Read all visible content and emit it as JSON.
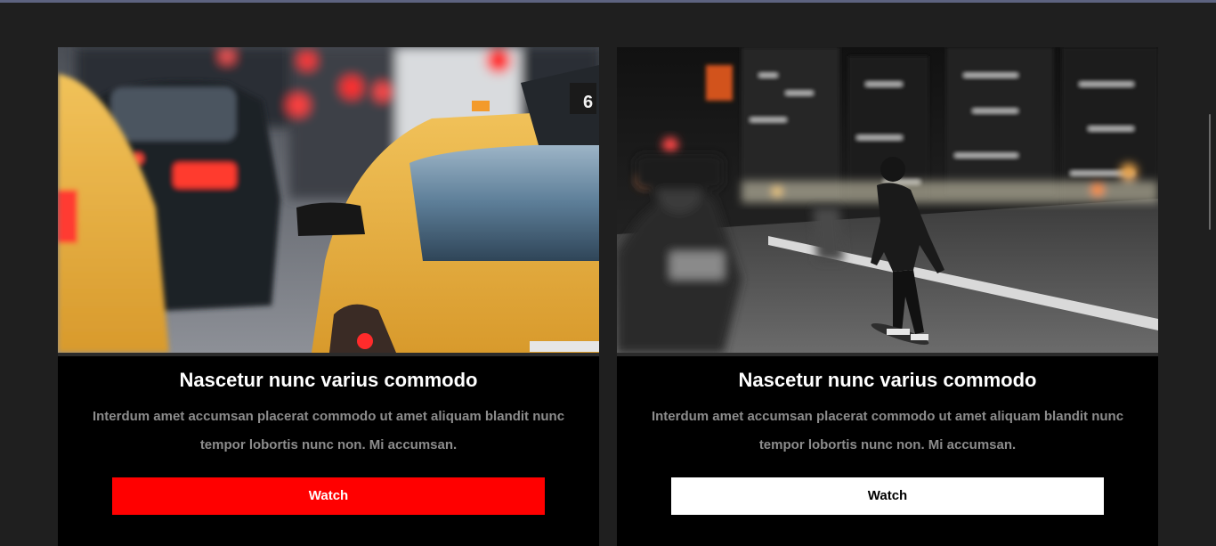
{
  "cards": [
    {
      "title": "Nascetur nunc varius commodo",
      "description": "Interdum amet accumsan placerat commodo ut amet aliquam blandit nunc tempor lobortis nunc non. Mi accumsan.",
      "button_label": "Watch",
      "button_color": "#ff0000",
      "button_text_color": "#ffffff",
      "image_subject": "taxi-traffic-photo"
    },
    {
      "title": "Nascetur nunc varius commodo",
      "description": "Interdum amet accumsan placerat commodo ut amet aliquam blandit nunc tempor lobortis nunc non. Mi accumsan.",
      "button_label": "Watch",
      "button_color": "#ffffff",
      "button_text_color": "#000000",
      "image_subject": "night-skateboarder-photo"
    }
  ],
  "colors": {
    "page_background": "#1f1f1f",
    "card_background": "#000000",
    "description_text": "#8c8c8c",
    "top_bar": "#5d6380"
  }
}
